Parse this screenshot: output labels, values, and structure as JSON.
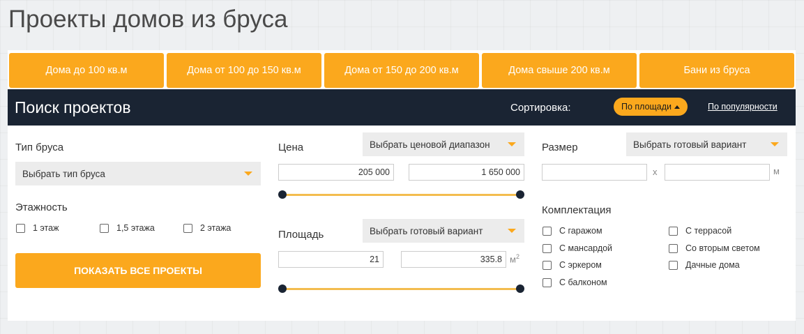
{
  "page_title": "Проекты домов из бруса",
  "tabs": [
    "Дома до 100 кв.м",
    "Дома от 100 до 150 кв.м",
    "Дома от 150 до 200 кв.м",
    "Дома свыше 200 кв.м",
    "Бани из бруса"
  ],
  "search": {
    "title": "Поиск проектов",
    "sort_label": "Сортировка:",
    "sort_active": "По площади",
    "sort_popular": "По популярности"
  },
  "filters": {
    "beam_type": {
      "label": "Тип бруса",
      "select": "Выбрать тип бруса"
    },
    "floors": {
      "label": "Этажность",
      "options": [
        "1 этаж",
        "1,5 этажа",
        "2 этажа"
      ]
    },
    "show_button": "ПОКАЗАТЬ ВСЕ ПРОЕКТЫ",
    "price": {
      "label": "Цена",
      "select": "Выбрать ценовой диапазон",
      "min": "205 000",
      "max": "1 650 000"
    },
    "area": {
      "label": "Площадь",
      "select": "Выбрать готовый вариант",
      "min": "21",
      "max": "335.8",
      "unit": "м",
      "unit_sup": "2"
    },
    "size": {
      "label": "Размер",
      "select": "Выбрать готовый вариант",
      "x_sep": "x",
      "unit": "м",
      "width": "",
      "length": ""
    },
    "equipment": {
      "label": "Комплектация",
      "options": [
        "С гаражом",
        "С мансардой",
        "С эркером",
        "С балконом",
        "С террасой",
        "Со вторым светом",
        "Дачные дома"
      ]
    }
  },
  "colors": {
    "accent": "#fba81d",
    "header_bg": "#1a2433",
    "slider": "#f3bc4e"
  }
}
